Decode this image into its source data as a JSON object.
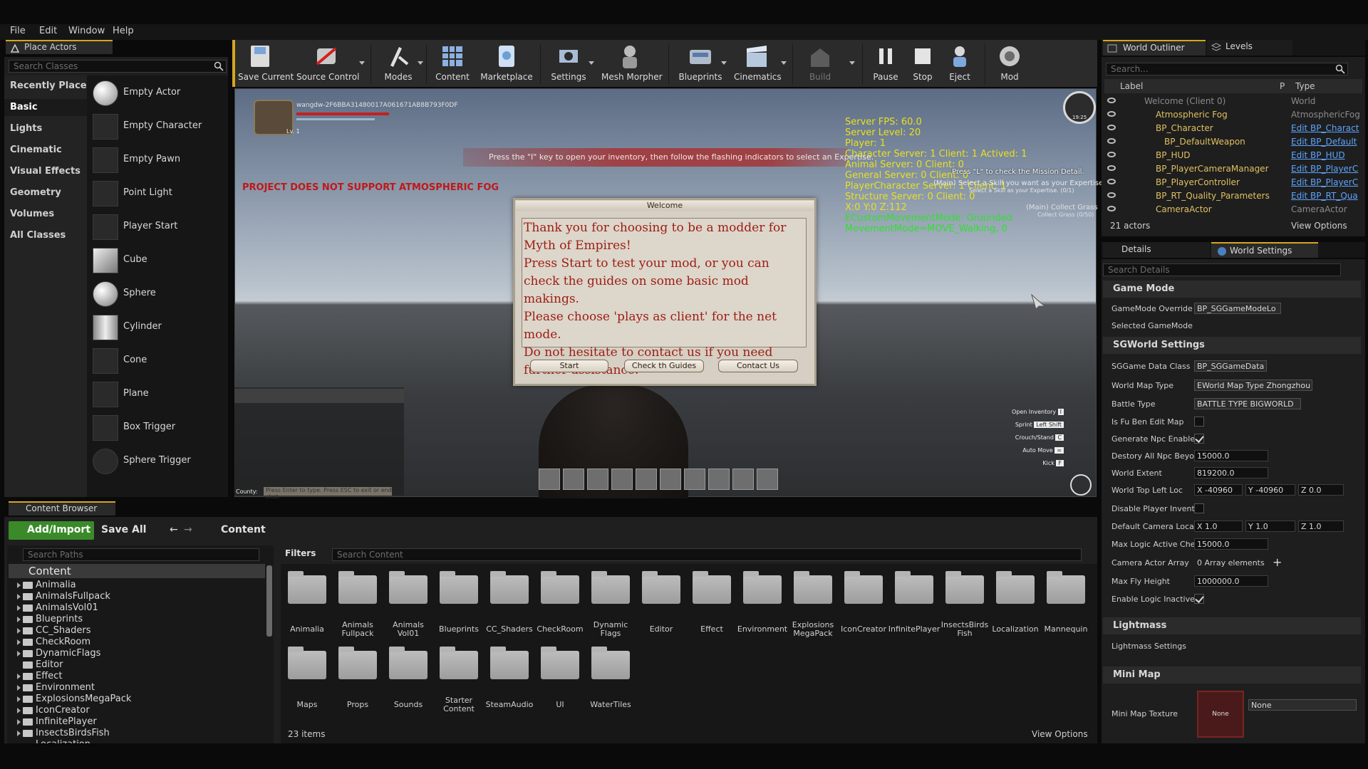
{
  "menu": [
    "File",
    "Edit",
    "Window",
    "Help"
  ],
  "place_actors": {
    "tab": "Place Actors",
    "search_placeholder": "Search Classes",
    "categories": [
      "Recently Placed",
      "Basic",
      "Lights",
      "Cinematic",
      "Visual Effects",
      "Geometry",
      "Volumes",
      "All Classes"
    ],
    "selected_category": "Basic",
    "actors": [
      "Empty Actor",
      "Empty Character",
      "Empty Pawn",
      "Point Light",
      "Player Start",
      "Cube",
      "Sphere",
      "Cylinder",
      "Cone",
      "Plane",
      "Box Trigger",
      "Sphere Trigger"
    ]
  },
  "toolbar": {
    "buttons": [
      "Save Current",
      "Source Control",
      "Modes",
      "Content",
      "Marketplace",
      "Settings",
      "Mesh Morpher",
      "Blueprints",
      "Cinematics",
      "Build",
      "Pause",
      "Stop",
      "Eject",
      "Mod"
    ]
  },
  "viewport": {
    "player_name": "wangdw-2F6BBA31480017A061671AB8B793F0DF",
    "level_badge": "Lv. 1",
    "notice": "Press the \"I\" key to open your inventory, then follow the flashing indicators to select an Expertise.",
    "atmos_warning": "PROJECT DOES NOT SUPPORT ATMOSPHERIC FOG",
    "stats": [
      "Server FPS: 60.0",
      "Server Level: 20",
      "Player: 1",
      "Character Server: 1 Client: 1 Actived: 1",
      "Animal Server: 0 Client: 0",
      "General Server: 0 Client: 0",
      "PlayerCharacter Server: 1 Client: 1",
      "Structure Server: 0 Client: 0",
      "X:0 Y:0 Z:112"
    ],
    "stats_green": [
      "ECustomMovementMode: Grounded",
      "MovementMode=MOVE_Walking, 0"
    ],
    "mission_line": "Press \"L\" to check the Mission Detail.",
    "mission_sub": "(Main) Select a Skill you want as your Expertise",
    "mission_sub2": "Select a Skill as your Expertise. (0/1)",
    "collect": "(Main) Collect Grass",
    "collect_sub": "Collect Grass (0/50)",
    "minimap_time": "19:25",
    "chat_prefix": "County:",
    "chat_placeholder": "Press Enter to type. Press ESC to exit or end chat.",
    "keys": [
      {
        "name": "Open Inventory",
        "key": "I"
      },
      {
        "name": "Sprint",
        "key": "Left Shift"
      },
      {
        "name": "Crouch/Stand",
        "key": "C"
      },
      {
        "name": "Auto Move",
        "key": "="
      },
      {
        "name": "Kick",
        "key": "F"
      }
    ],
    "welcome": {
      "title": "Welcome",
      "text": "Thank you for choosing to be a modder for Myth of Empires!\nPress Start to test your mod, or you can check the guides on some basic mod makings.\nPlease choose 'plays as client' for the net mode.\nDo not hesitate to contact us if you need further assistance.",
      "buttons": [
        "Start",
        "Check th Guides",
        "Contact Us"
      ]
    }
  },
  "outliner": {
    "tabs": [
      "World Outliner",
      "Levels"
    ],
    "search_placeholder": "Search...",
    "columns": [
      "Label",
      "P",
      "Type"
    ],
    "rows": [
      {
        "name": "Welcome (Client 0)",
        "type": "World",
        "link": false
      },
      {
        "name": "Atmospheric Fog",
        "type": "AtmosphericFog",
        "link": false
      },
      {
        "name": "BP_Character",
        "type": "Edit BP_Charact",
        "link": true
      },
      {
        "name": "BP_DefaultWeapon",
        "type": "Edit BP_Default",
        "link": true
      },
      {
        "name": "BP_HUD",
        "type": "Edit BP_HUD",
        "link": true
      },
      {
        "name": "BP_PlayerCameraManager",
        "type": "Edit BP_PlayerC",
        "link": true
      },
      {
        "name": "BP_PlayerController",
        "type": "Edit BP_PlayerC",
        "link": true
      },
      {
        "name": "BP_RT_Quality_Parameters",
        "type": "Edit BP_RT_Qua",
        "link": true
      },
      {
        "name": "CameraActor",
        "type": "CameraActor",
        "link": false
      }
    ],
    "count": "21 actors",
    "view_options": "View Options"
  },
  "details": {
    "tabs": [
      "Details",
      "World Settings"
    ],
    "search_placeholder": "Search Details",
    "sections": {
      "game_mode": "Game Mode",
      "sgworld": "SGWorld Settings",
      "lightmass": "Lightmass",
      "minimap": "Mini Map"
    },
    "props": {
      "gamemode_override": "GameMode Override",
      "gamemode_value": "BP_SGGameModeLo",
      "selected_gamemode": "Selected GameMode",
      "sggame_data_class": "SGGame Data Class",
      "sggame_data_value": "BP_SGGameData",
      "world_map_type": "World Map Type",
      "world_map_value": "EWorld Map Type Zhongzhou",
      "battle_type": "Battle Type",
      "battle_value": "BATTLE TYPE BIGWORLD",
      "fuben": "Is Fu Ben Edit Map",
      "gen_npc": "Generate Npc Enable",
      "destroy_npc": "Destory All Npc Beyon",
      "destroy_npc_value": "15000.0",
      "world_extent": "World Extent",
      "world_extent_value": "819200.0",
      "top_left": "World Top Left Loc",
      "top_left_x": "-40960",
      "top_left_y": "-40960",
      "top_left_z": "0.0",
      "disable_inv": "Disable Player Invento",
      "cam_loc": "Default Camera Locat",
      "cam_x": "1.0",
      "cam_y": "1.0",
      "cam_z": "1.0",
      "max_logic": "Max Logic Active Chec",
      "max_logic_value": "15000.0",
      "cam_array": "Camera Actor Array",
      "cam_array_value": "0 Array elements",
      "max_fly": "Max Fly Height",
      "max_fly_value": "1000000.0",
      "logic_inactive": "Enable Logic Inactive",
      "lightmass_settings": "Lightmass Settings",
      "minimap_texture": "Mini Map Texture",
      "minimap_none": "None",
      "minimap_thumb": "None"
    }
  },
  "content_browser": {
    "tab": "Content Browser",
    "add_import": "Add/Import",
    "save_all": "Save All",
    "path": "Content",
    "search_paths": "Search Paths",
    "filters": "Filters",
    "search_content": "Search Content",
    "tree_root": "Content",
    "tree": [
      "Animalia",
      "AnimalsFullpack",
      "AnimalsVol01",
      "Blueprints",
      "CC_Shaders",
      "CheckRoom",
      "DynamicFlags",
      "Editor",
      "Effect",
      "Environment",
      "ExplosionsMegaPack",
      "IconCreator",
      "InfinitePlayer",
      "InsectsBirdsFish",
      "Localization"
    ],
    "folders_row1": [
      "Animalia",
      "Animals\nFullpack",
      "Animals\nVol01",
      "Blueprints",
      "CC_Shaders",
      "CheckRoom",
      "Dynamic\nFlags",
      "Editor",
      "Effect",
      "Environment",
      "Explosions\nMegaPack",
      "IconCreator",
      "InfinitePlayer",
      "InsectsBirds\nFish",
      "Localization",
      "Mannequin"
    ],
    "folders_row2": [
      "Maps",
      "Props",
      "Sounds",
      "Starter\nContent",
      "SteamAudio",
      "UI",
      "WaterTiles"
    ],
    "count": "23 items",
    "view_options": "View Options"
  }
}
